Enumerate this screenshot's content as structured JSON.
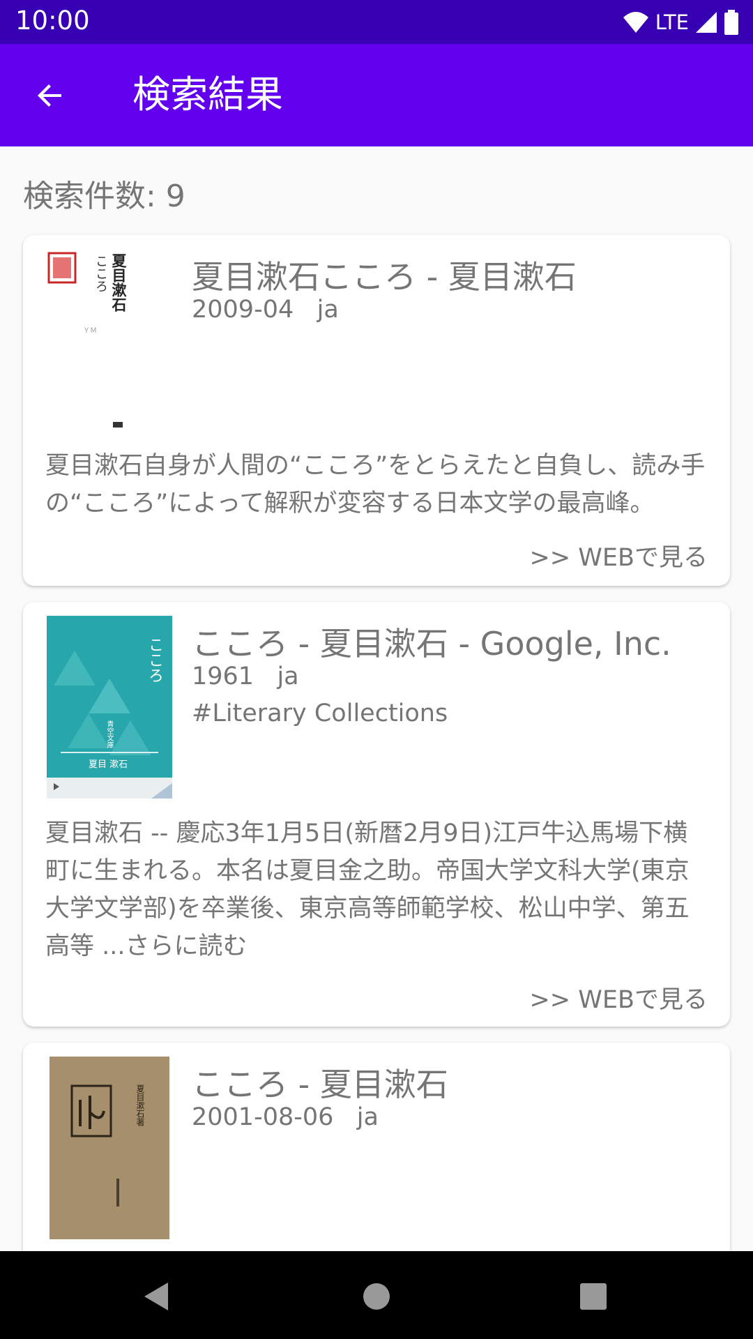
{
  "status_bar": {
    "time": "10:00",
    "network": "LTE"
  },
  "app_bar": {
    "title": "検索結果",
    "back_icon": "arrow-back-icon"
  },
  "result_count": "検索件数: 9",
  "results": [
    {
      "title": "夏目漱石こころ - 夏目漱石",
      "meta": "2009-04   ja",
      "description": "夏目漱石自身が人間の“こころ”をとらえたと自負し、読み手の“こころ”によって解釈が変容する日本文学の最高峰。",
      "link_label": ">> WEBで見る",
      "cover_title": "夏目漱石",
      "cover_subtitle": "こころ"
    },
    {
      "title": "こころ - 夏目漱石 - Google, Inc.",
      "meta": "1961   ja",
      "category": "#Literary Collections",
      "description": "夏目漱石 -- 慶応3年1月5日(新暦2月9日)江戸牛込馬場下横町に生まれる。本名は夏目金之助。帝国大学文科大学(東京大学文学部)を卒業後、東京高等師範学校、松山中学、第五高等 ...さらに読む",
      "link_label": ">> WEBで見る",
      "cover_title": "こころ",
      "cover_series": "青空文庫",
      "cover_author": "夏目 漱石"
    },
    {
      "title": "こころ - 夏目漱石",
      "meta": "2001-08-06   ja",
      "cover_title": "夏目漱石著"
    }
  ],
  "colors": {
    "status_bar": "#3700b3",
    "app_bar": "#6200ee",
    "text_secondary": "#757575",
    "background": "#fafafa"
  }
}
